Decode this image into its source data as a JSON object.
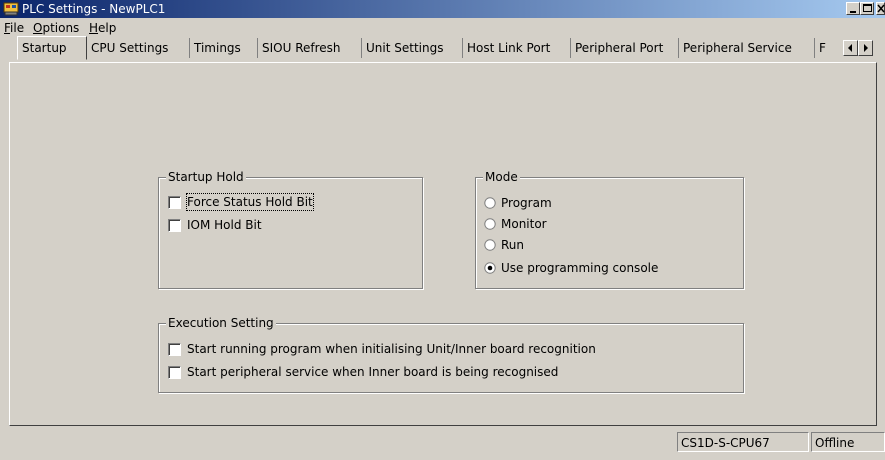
{
  "window": {
    "title": "PLC Settings - NewPLC1"
  },
  "menu": [
    {
      "accel": "F",
      "rest": "ile"
    },
    {
      "accel": "O",
      "rest": "ptions"
    },
    {
      "accel": "H",
      "rest": "elp"
    }
  ],
  "tabs": [
    {
      "label": "Startup",
      "active": true
    },
    {
      "label": "CPU Settings"
    },
    {
      "label": "Timings"
    },
    {
      "label": "SIOU Refresh"
    },
    {
      "label": "Unit Settings"
    },
    {
      "label": "Host Link Port"
    },
    {
      "label": "Peripheral Port"
    },
    {
      "label": "Peripheral Service"
    },
    {
      "label": "F"
    }
  ],
  "startup_hold": {
    "title": "Startup Hold",
    "options": [
      {
        "label": "Force Status Hold Bit",
        "checked": false,
        "focused": true
      },
      {
        "label": "IOM Hold Bit",
        "checked": false
      }
    ]
  },
  "mode": {
    "title": "Mode",
    "options": [
      {
        "label": "Program",
        "selected": false
      },
      {
        "label": "Monitor",
        "selected": false
      },
      {
        "label": "Run",
        "selected": false
      },
      {
        "label": "Use programming console",
        "selected": true
      }
    ]
  },
  "execution_setting": {
    "title": "Execution Setting",
    "options": [
      {
        "label": "Start running program when initialising Unit/Inner board recognition",
        "checked": false
      },
      {
        "label": "Start peripheral service when Inner board is being recognised",
        "checked": false
      }
    ]
  },
  "status": {
    "model": "CS1D-S-CPU67",
    "connection": "Offline"
  }
}
